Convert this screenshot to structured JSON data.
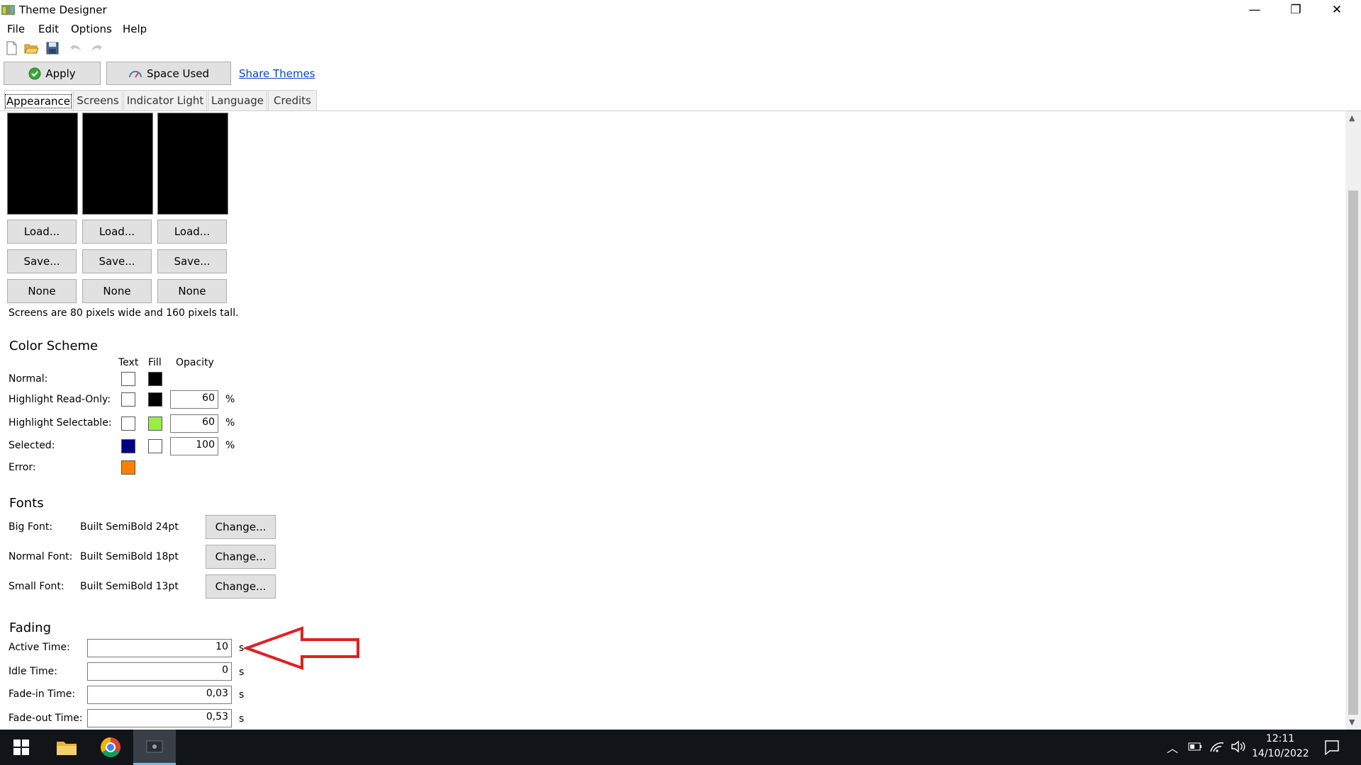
{
  "window": {
    "title": "Theme Designer",
    "minimize_glyph": "—",
    "restore_glyph": "❐",
    "close_glyph": "✕"
  },
  "menu": [
    "File",
    "Edit",
    "Options",
    "Help"
  ],
  "toolbar": {
    "icons": [
      "new-file-icon",
      "open-folder-icon",
      "save-icon",
      "undo-icon",
      "redo-icon"
    ]
  },
  "actions": {
    "apply_label": "Apply",
    "space_used_label": "Space Used",
    "share_link": "Share Themes"
  },
  "tabs": [
    "Appearance",
    "Screens",
    "Indicator Light",
    "Language",
    "Credits"
  ],
  "active_tab": "Appearance",
  "screens": {
    "load_label": "Load...",
    "save_label": "Save...",
    "none_label": "None",
    "note": "Screens are 80 pixels wide and 160 pixels tall."
  },
  "color_scheme": {
    "heading": "Color Scheme",
    "col_text": "Text",
    "col_fill": "Fill",
    "col_opacity": "Opacity",
    "percent": "%",
    "rows": [
      {
        "label": "Normal:",
        "text_color": "#ffffff",
        "fill_color": "#000000",
        "opacity": null
      },
      {
        "label": "Highlight Read-Only:",
        "text_color": "#ffffff",
        "fill_color": "#000000",
        "opacity": "60"
      },
      {
        "label": "Highlight Selectable:",
        "text_color": "#ffffff",
        "fill_color": "#99ee44",
        "opacity": "60"
      },
      {
        "label": "Selected:",
        "text_color": "#000080",
        "fill_color": "#ffffff",
        "opacity": "100"
      },
      {
        "label": "Error:",
        "text_color": "#ff8000",
        "fill_color": null,
        "opacity": null
      }
    ]
  },
  "fonts": {
    "heading": "Fonts",
    "change_label": "Change...",
    "rows": [
      {
        "label": "Big Font:",
        "value": "Built SemiBold 24pt"
      },
      {
        "label": "Normal Font:",
        "value": "Built SemiBold 18pt"
      },
      {
        "label": "Small Font:",
        "value": "Built SemiBold 13pt"
      }
    ]
  },
  "fading": {
    "heading": "Fading",
    "unit": "s",
    "rows": [
      {
        "label": "Active Time:",
        "value": "10"
      },
      {
        "label": "Idle Time:",
        "value": "0"
      },
      {
        "label": "Fade-in Time:",
        "value": "0,03"
      },
      {
        "label": "Fade-out Time:",
        "value": "0,53"
      }
    ]
  },
  "annotation": {
    "arrow_color": "#e02020"
  },
  "taskbar": {
    "time": "12:11",
    "date": "14/10/2022"
  }
}
